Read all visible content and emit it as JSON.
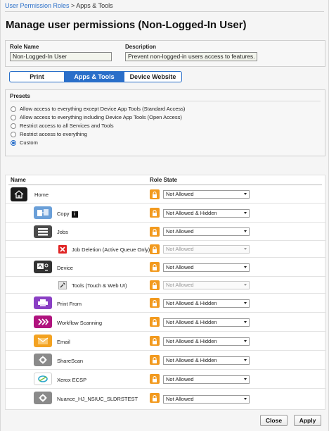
{
  "breadcrumb": {
    "parent": "User Permission Roles",
    "separator": " > ",
    "current": "Apps & Tools"
  },
  "page": {
    "title": "Manage user permissions (Non-Logged-In User)"
  },
  "role": {
    "name_label": "Role Name",
    "name_value": "Non-Logged-In User",
    "desc_label": "Description",
    "desc_value": "Prevent non-logged-in users access to features."
  },
  "tabs": [
    {
      "label": "Print",
      "active": false
    },
    {
      "label": "Apps & Tools",
      "active": true
    },
    {
      "label": "Device Website",
      "active": false
    }
  ],
  "presets": {
    "heading": "Presets",
    "options": [
      {
        "label": "Allow access to everything except Device App Tools (Standard Access)",
        "selected": false
      },
      {
        "label": "Allow access to everything including Device App Tools (Open Access)",
        "selected": false
      },
      {
        "label": "Restrict access to all Services and Tools",
        "selected": false
      },
      {
        "label": "Restrict access to everything",
        "selected": false
      },
      {
        "label": "Custom",
        "selected": true
      }
    ]
  },
  "table": {
    "col_name": "Name",
    "col_state": "Role State",
    "rows": [
      {
        "name": "Home",
        "icon": "home-icon",
        "state": "Not Allowed",
        "disabled": false,
        "level": 0
      },
      {
        "name": "Copy",
        "icon": "copy-icon",
        "state": "Not Allowed & Hidden",
        "disabled": false,
        "level": 1,
        "info": "i"
      },
      {
        "name": "Jobs",
        "icon": "jobs-icon",
        "state": "Not Allowed",
        "disabled": false,
        "level": 1
      },
      {
        "name": "Job Deletion (Active Queue Only)",
        "icon": "delete-x-icon",
        "state": "Not Allowed",
        "disabled": true,
        "level": 2
      },
      {
        "name": "Device",
        "icon": "device-icon",
        "state": "Not Allowed",
        "disabled": false,
        "level": 1
      },
      {
        "name": "Tools (Touch & Web UI)",
        "icon": "wrench-icon",
        "state": "Not Allowed",
        "disabled": true,
        "level": 2
      },
      {
        "name": "Print From",
        "icon": "printer-icon",
        "state": "Not Allowed & Hidden",
        "disabled": false,
        "level": 1
      },
      {
        "name": "Workflow Scanning",
        "icon": "workflow-icon",
        "state": "Not Allowed & Hidden",
        "disabled": false,
        "level": 1
      },
      {
        "name": "Email",
        "icon": "envelope-icon",
        "state": "Not Allowed & Hidden",
        "disabled": false,
        "level": 1
      },
      {
        "name": "ShareScan",
        "icon": "gear-icon",
        "state": "Not Allowed & Hidden",
        "disabled": false,
        "level": 1
      },
      {
        "name": "Xerox ECSP",
        "icon": "xerox-icon",
        "state": "Not Allowed",
        "disabled": false,
        "level": 1
      },
      {
        "name": "Nuance_HJ_NSIUC_SLDRSTEST",
        "icon": "gear-icon",
        "state": "Not Allowed",
        "disabled": false,
        "level": 1
      }
    ]
  },
  "buttons": {
    "close": "Close",
    "apply": "Apply"
  },
  "colors": {
    "accent": "#2a6fc9",
    "lock": "#f29a1f",
    "print_icon": "#8a3fc4",
    "workflow_icon": "#b0137e",
    "email_icon": "#f3a221"
  }
}
